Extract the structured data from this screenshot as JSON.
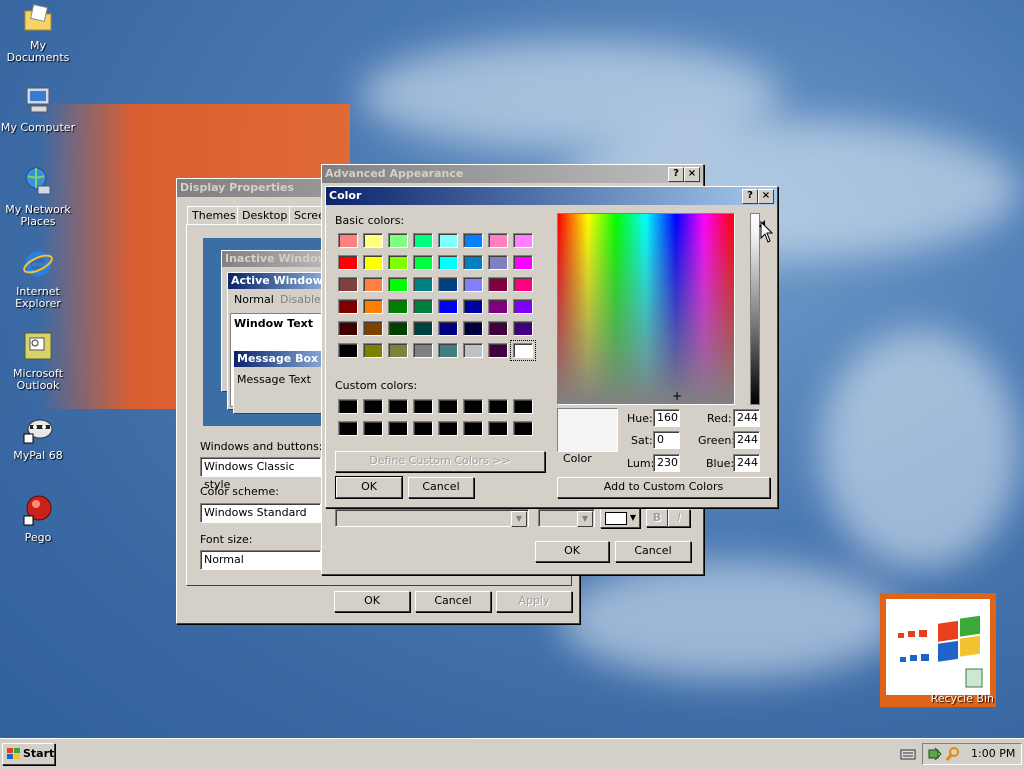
{
  "desktop": {
    "icons": [
      {
        "label": "My Documents",
        "icon": "folder-documents-icon"
      },
      {
        "label": "My Computer",
        "icon": "computer-icon"
      },
      {
        "label": "My Network Places",
        "icon": "network-icon"
      },
      {
        "label": "Internet Explorer",
        "icon": "internet-explorer-icon"
      },
      {
        "label": "Microsoft Outlook",
        "icon": "outlook-icon"
      },
      {
        "label": "MyPal 68",
        "icon": "mypal-icon"
      },
      {
        "label": "Pego",
        "icon": "pego-icon"
      }
    ],
    "recycle_bin": "Recycle Bin"
  },
  "display_properties": {
    "title": "Display Properties",
    "tabs": [
      "Themes",
      "Desktop",
      "Scree"
    ],
    "preview": {
      "inactive": "Inactive Window",
      "active": "Active Window",
      "menu_normal": "Normal",
      "menu_disabled": "Disabled",
      "window_text": "Window Text",
      "msgbox_title": "Message Box",
      "msgbox_text": "Message Text"
    },
    "windows_buttons_label": "Windows and buttons:",
    "windows_buttons_value": "Windows Classic style",
    "color_scheme_label": "Color scheme:",
    "color_scheme_value": "Windows Standard",
    "font_size_label": "Font size:",
    "font_size_value": "Normal",
    "ok": "OK",
    "cancel": "Cancel",
    "apply": "Apply"
  },
  "advanced_appearance": {
    "title": "Advanced Appearance",
    "help": "?",
    "close": "×",
    "bold": "B",
    "italic": "I",
    "ok": "OK",
    "cancel": "Cancel"
  },
  "color_dialog": {
    "title": "Color",
    "help": "?",
    "close": "×",
    "basic_colors_label": "Basic colors:",
    "custom_colors_label": "Custom colors:",
    "define_custom": "Define Custom Colors >>",
    "ok": "OK",
    "cancel": "Cancel",
    "color_label": "Color",
    "hue_label": "Hue:",
    "sat_label": "Sat:",
    "lum_label": "Lum:",
    "red_label": "Red:",
    "green_label": "Green:",
    "blue_label": "Blue:",
    "hue": "160",
    "sat": "0",
    "lum": "230",
    "red": "244",
    "green": "244",
    "blue": "244",
    "add_custom": "Add to Custom Colors",
    "current_color": "#f4f4f4",
    "basic_colors": [
      [
        "#ff8080",
        "#ffff80",
        "#80ff80",
        "#00ff80",
        "#80ffff",
        "#0080ff",
        "#ff80c0",
        "#ff80ff"
      ],
      [
        "#ff0000",
        "#ffff00",
        "#80ff00",
        "#00ff40",
        "#00ffff",
        "#0080c0",
        "#8080c0",
        "#ff00ff"
      ],
      [
        "#804040",
        "#ff8040",
        "#00ff00",
        "#008080",
        "#004080",
        "#8080ff",
        "#800040",
        "#ff0080"
      ],
      [
        "#800000",
        "#ff8000",
        "#008000",
        "#008040",
        "#0000ff",
        "#0000a0",
        "#800080",
        "#8000ff"
      ],
      [
        "#400000",
        "#804000",
        "#004000",
        "#004040",
        "#000080",
        "#000040",
        "#400040",
        "#400080"
      ],
      [
        "#000000",
        "#808000",
        "#808040",
        "#808080",
        "#408080",
        "#c0c0c0",
        "#400040",
        "#ffffff"
      ]
    ],
    "custom_colors": [
      [
        "#000000",
        "#000000",
        "#000000",
        "#000000",
        "#000000",
        "#000000",
        "#000000",
        "#000000"
      ],
      [
        "#000000",
        "#000000",
        "#000000",
        "#000000",
        "#000000",
        "#000000",
        "#000000",
        "#000000"
      ]
    ]
  },
  "taskbar": {
    "start": "Start",
    "clock": "1:00 PM"
  }
}
